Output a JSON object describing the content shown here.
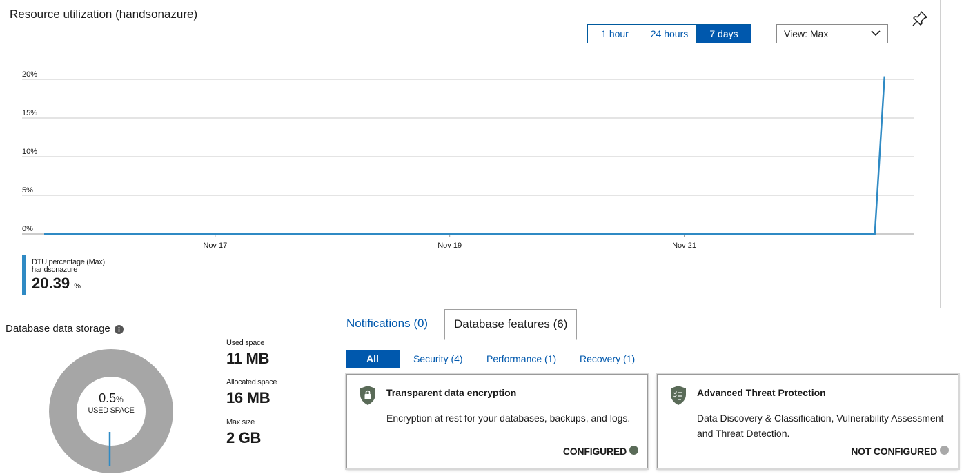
{
  "header": {
    "title": "Resource utilization (handsonazure)",
    "time_ranges": [
      "1 hour",
      "24 hours",
      "7 days"
    ],
    "active_range": "7 days",
    "view_select": "View: Max"
  },
  "chart_data": {
    "type": "line",
    "title": "",
    "y_ticks": [
      "20%",
      "15%",
      "10%",
      "5%",
      "0%"
    ],
    "ylim": [
      0,
      20
    ],
    "x_ticks": [
      "Nov 17",
      "Nov 19",
      "Nov 21"
    ],
    "series": [
      {
        "name": "DTU percentage (Max)",
        "color": "#2f8ac4",
        "points": [
          {
            "x": "Nov 15 13:00",
            "y": 0
          },
          {
            "x": "Nov 22 15:00",
            "y": 0
          },
          {
            "x": "Nov 22 17:00",
            "y": 20.39
          }
        ]
      }
    ],
    "grid": true
  },
  "legend": {
    "metric": "DTU percentage (Max)",
    "resource": "handsonazure",
    "value": "20.39",
    "unit": "%"
  },
  "storage": {
    "title": "Database data storage",
    "used_percent": "0.5",
    "used_percent_symbol": "%",
    "used_label": "USED SPACE",
    "stats": [
      {
        "label": "Used space",
        "value": "11 MB"
      },
      {
        "label": "Allocated space",
        "value": "16 MB"
      },
      {
        "label": "Max size",
        "value": "2 GB"
      }
    ],
    "ring_color": "#a6a6a6",
    "used_color": "#2f8ac4"
  },
  "tabs": {
    "notifications": "Notifications (0)",
    "features": "Database features (6)"
  },
  "filters": {
    "all": "All",
    "security": "Security (4)",
    "performance": "Performance (1)",
    "recovery": "Recovery (1)"
  },
  "cards": [
    {
      "title": "Transparent data encryption",
      "description": "Encryption at rest for your databases, backups, and logs.",
      "status": "CONFIGURED",
      "status_color": "#5a6b58",
      "icon": "lock-shield-icon"
    },
    {
      "title": "Advanced Threat Protection",
      "description": "Data Discovery & Classification, Vulnerability Assessment and Threat Detection.",
      "status": "NOT CONFIGURED",
      "status_color": "#a9a9a9",
      "icon": "checklist-shield-icon"
    }
  ]
}
